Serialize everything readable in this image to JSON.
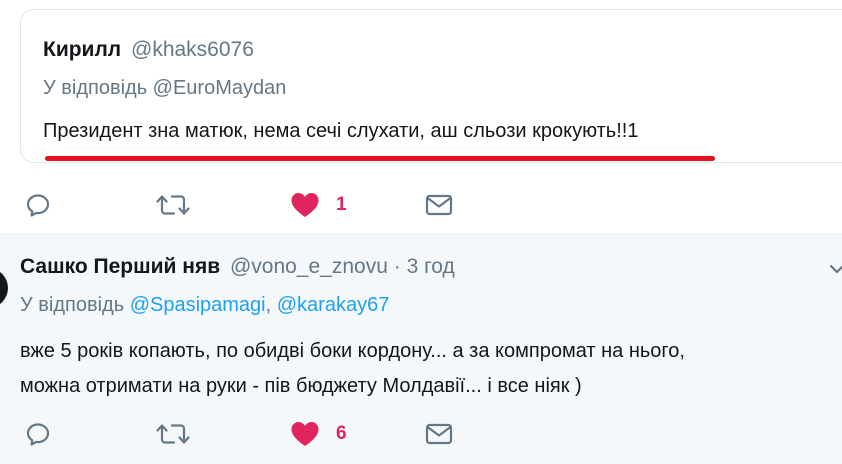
{
  "quoted_tweet": {
    "author_name": "Кирилл",
    "author_handle": "@khaks6076",
    "reply_to": "У відповідь @EuroMaydan",
    "text": "Президент зна матюк, нема сечі слухати, аш сльози крокують!!1"
  },
  "actions_1": {
    "like_count": "1",
    "like_color": "#e0245e"
  },
  "reply_tweet": {
    "author_name": "Сашко Перший няв",
    "author_handle": "@vono_e_znovu",
    "separator": "·",
    "time": "3 год",
    "reply_prefix": "У відповідь",
    "mention_1": "@Spasipamagi",
    "mention_sep": ",",
    "mention_2": "@karakay67",
    "text_line_1": "вже 5 років копають, по обидві боки кордону... а за компромат на нього,",
    "text_line_2": "можна отримати на руки -  пів бюджету Молдавії... і все ніяк )"
  },
  "actions_2": {
    "like_count": "6",
    "like_color": "#e0245e"
  },
  "icons": {
    "reply": "reply-bubble-icon",
    "retweet": "retweet-icon",
    "like": "heart-icon",
    "dm": "envelope-icon",
    "menu": "chevron-down-icon"
  },
  "colors": {
    "link": "#1da1f2",
    "secondary_text": "#657786",
    "highlight_underline": "#e0131e"
  }
}
